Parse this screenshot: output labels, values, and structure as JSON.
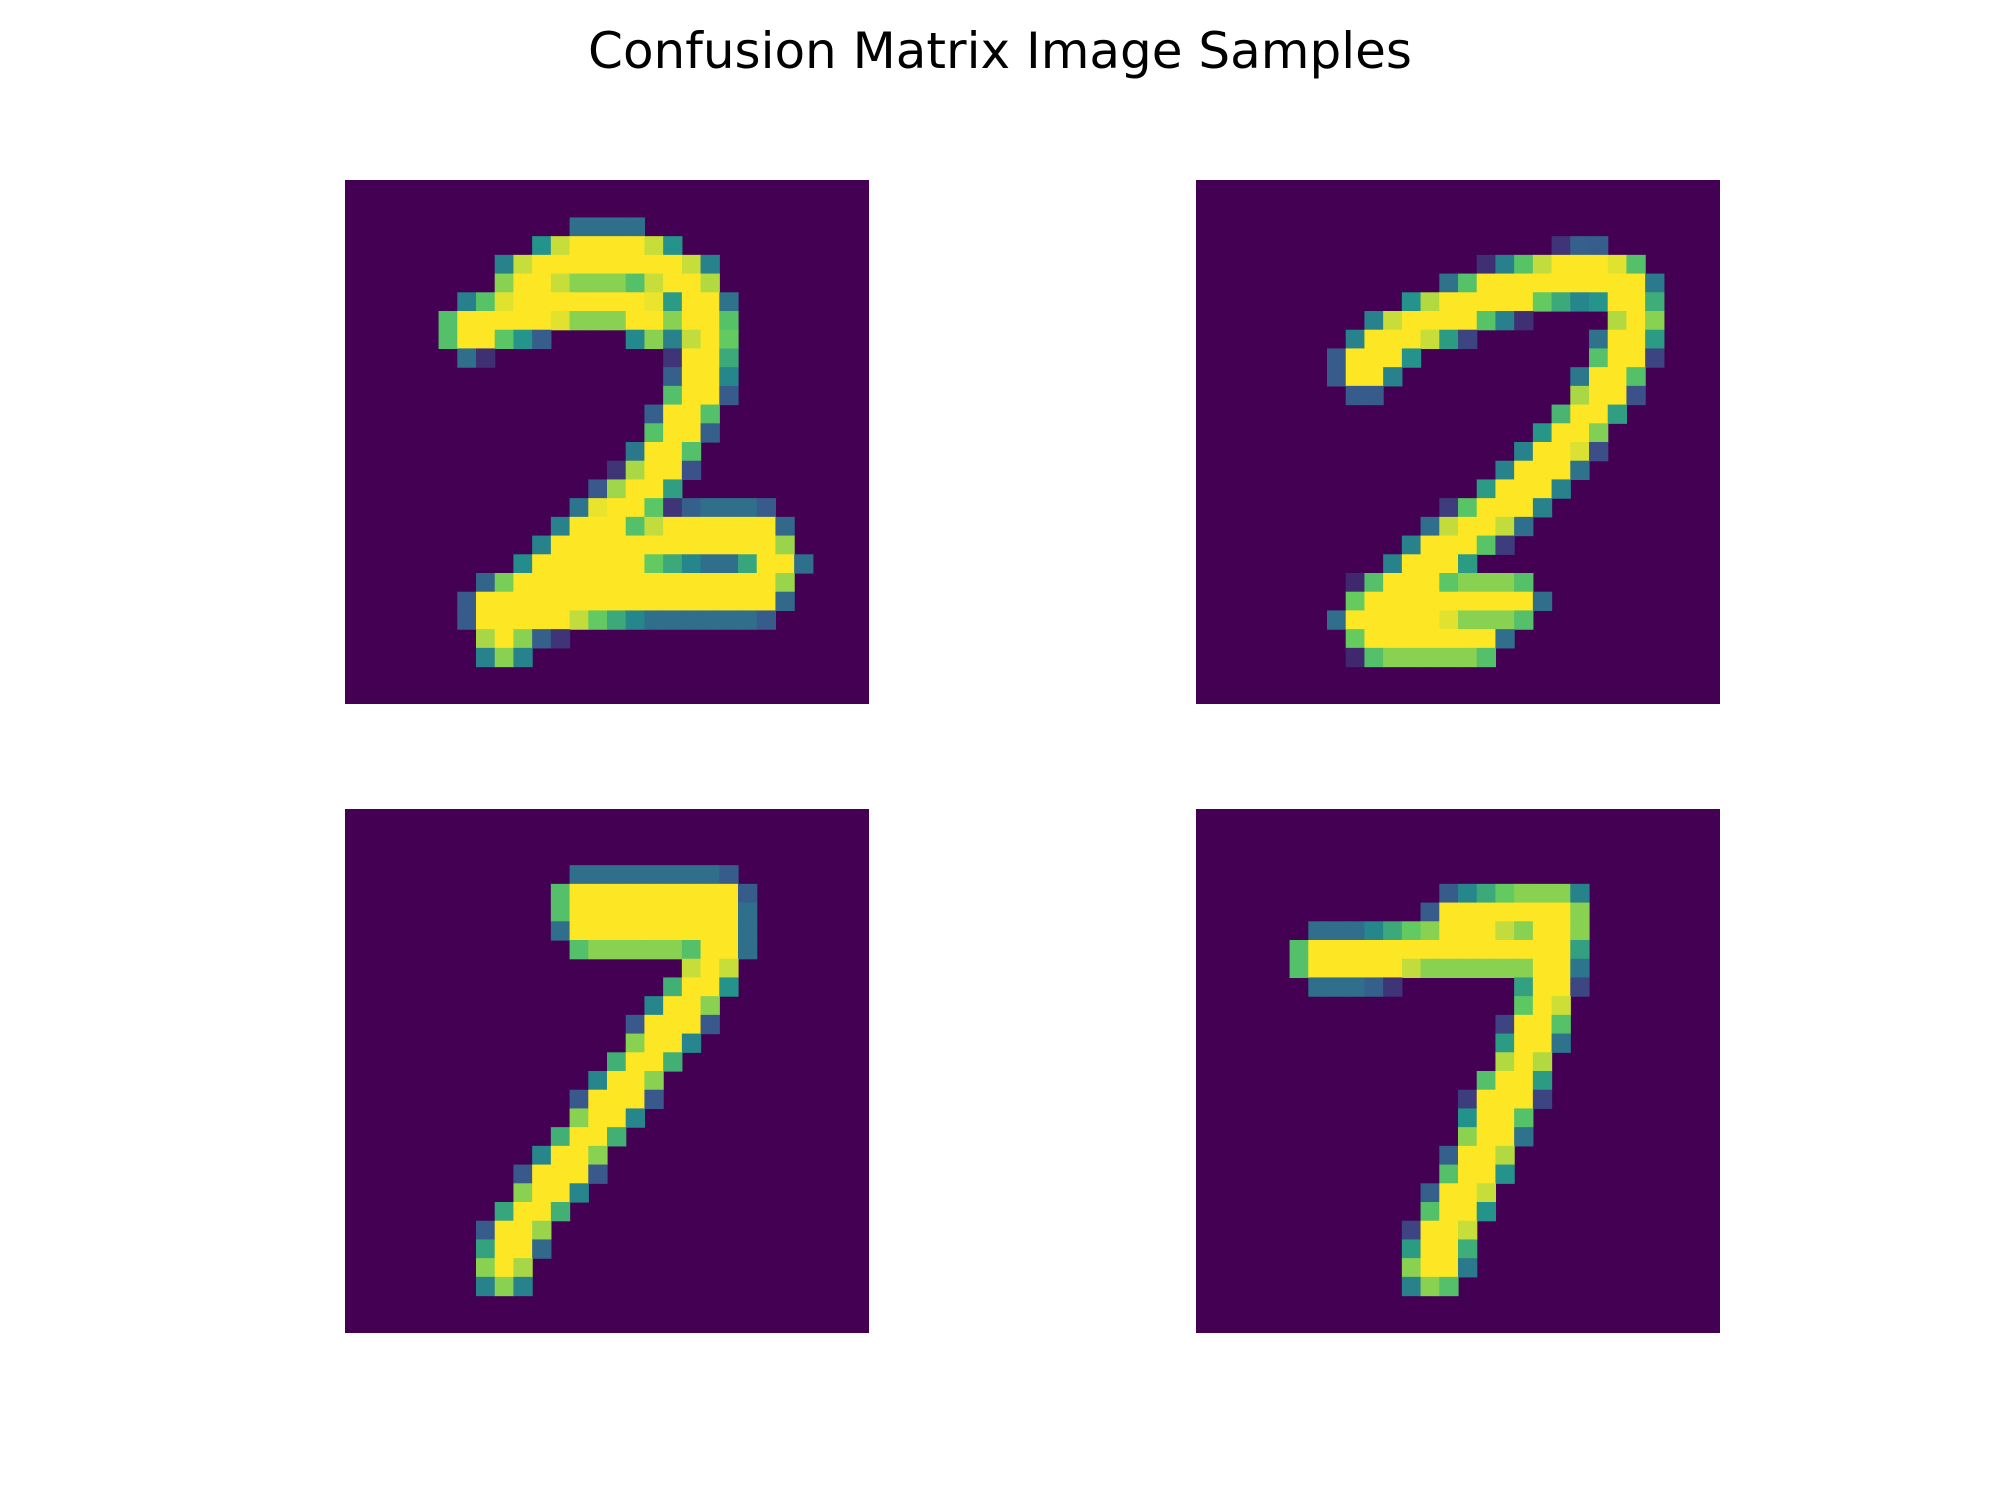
{
  "title": "Confusion Matrix Image Samples",
  "colors": {
    "background": "#440154",
    "colormap": "viridis"
  },
  "chart_data": {
    "type": "heatmap",
    "title": "Confusion Matrix Image Samples",
    "grid": false,
    "axes": "off",
    "image_size": [
      28,
      28
    ],
    "panels": [
      {
        "position": "top-left",
        "digit": "2",
        "strokes": [
          [
            [
              9.5,
              5.5
            ],
            [
              12.5,
              4
            ],
            [
              15.5,
              4
            ],
            [
              18.5,
              5.5
            ],
            [
              19.5,
              8
            ],
            [
              19,
              11
            ],
            [
              17.5,
              14
            ],
            [
              16,
              16.5
            ],
            [
              13,
              19
            ],
            [
              10.5,
              21.5
            ],
            [
              8,
              23
            ],
            [
              8.5,
              24.5
            ]
          ],
          [
            [
              6.5,
              8
            ],
            [
              8,
              7.5
            ],
            [
              10,
              7
            ],
            [
              12,
              6.5
            ],
            [
              15,
              6.5
            ],
            [
              16.5,
              7.5
            ]
          ],
          [
            [
              9,
              22.5
            ],
            [
              12,
              21.5
            ],
            [
              14,
              20.5
            ],
            [
              16,
              19.5
            ],
            [
              19,
              19
            ],
            [
              22,
              19
            ],
            [
              23,
              20.5
            ],
            [
              22,
              22
            ],
            [
              19,
              22
            ],
            [
              16,
              22
            ],
            [
              13,
              22.5
            ],
            [
              10,
              23
            ]
          ]
        ]
      },
      {
        "position": "top-right",
        "digit": "2",
        "strokes": [
          [
            [
              9,
              10
            ],
            [
              10.5,
              8.5
            ],
            [
              12.5,
              7.5
            ],
            [
              15,
              6.5
            ],
            [
              18,
              5.5
            ],
            [
              21,
              5
            ],
            [
              23,
              5.5
            ],
            [
              23.5,
              7.5
            ],
            [
              22.5,
              10
            ],
            [
              21,
              12.5
            ],
            [
              19,
              15
            ],
            [
              17,
              17
            ],
            [
              15,
              18.5
            ],
            [
              13,
              20
            ],
            [
              11.5,
              21.5
            ],
            [
              10,
              23
            ]
          ],
          [
            [
              10,
              23
            ],
            [
              12,
              23
            ],
            [
              14,
              22.5
            ],
            [
              16,
              22.5
            ],
            [
              17,
              22.5
            ]
          ],
          [
            [
              10,
              22.5
            ],
            [
              9,
              23.5
            ],
            [
              10,
              24.5
            ],
            [
              12,
              24.5
            ],
            [
              15,
              24.5
            ]
          ]
        ]
      },
      {
        "position": "bottom-left",
        "digit": "7",
        "strokes": [
          [
            [
              12.5,
              5
            ],
            [
              15,
              5
            ],
            [
              17.5,
              5
            ],
            [
              20,
              5
            ]
          ],
          [
            [
              13,
              6.5
            ],
            [
              15.5,
              6.5
            ],
            [
              18,
              6.5
            ]
          ],
          [
            [
              20,
              5.5
            ],
            [
              20,
              7.5
            ],
            [
              19,
              9.5
            ],
            [
              17.5,
              11.5
            ],
            [
              16,
              13.5
            ],
            [
              14.5,
              15.5
            ],
            [
              13,
              17.5
            ],
            [
              11.5,
              19.5
            ],
            [
              10,
              21.5
            ],
            [
              9,
              23
            ],
            [
              8.5,
              24.5
            ]
          ]
        ]
      },
      {
        "position": "bottom-right",
        "digit": "7",
        "strokes": [
          [
            [
              6.5,
              8
            ],
            [
              9,
              8
            ],
            [
              12,
              7.5
            ],
            [
              15,
              7.5
            ],
            [
              18,
              7.5
            ],
            [
              19.5,
              6.5
            ]
          ],
          [
            [
              14,
              6
            ],
            [
              17,
              5.5
            ],
            [
              19.5,
              5.5
            ]
          ],
          [
            [
              19.5,
              6
            ],
            [
              19,
              8.5
            ],
            [
              18.5,
              11
            ],
            [
              17.5,
              13.5
            ],
            [
              16.5,
              16
            ],
            [
              15.5,
              18.5
            ],
            [
              14.5,
              20.5
            ],
            [
              13.5,
              22.5
            ],
            [
              13,
              24.5
            ]
          ],
          [
            [
              12.5,
              24.5
            ],
            [
              13.5,
              22
            ],
            [
              15,
              19
            ],
            [
              16.5,
              15
            ]
          ]
        ]
      }
    ]
  }
}
